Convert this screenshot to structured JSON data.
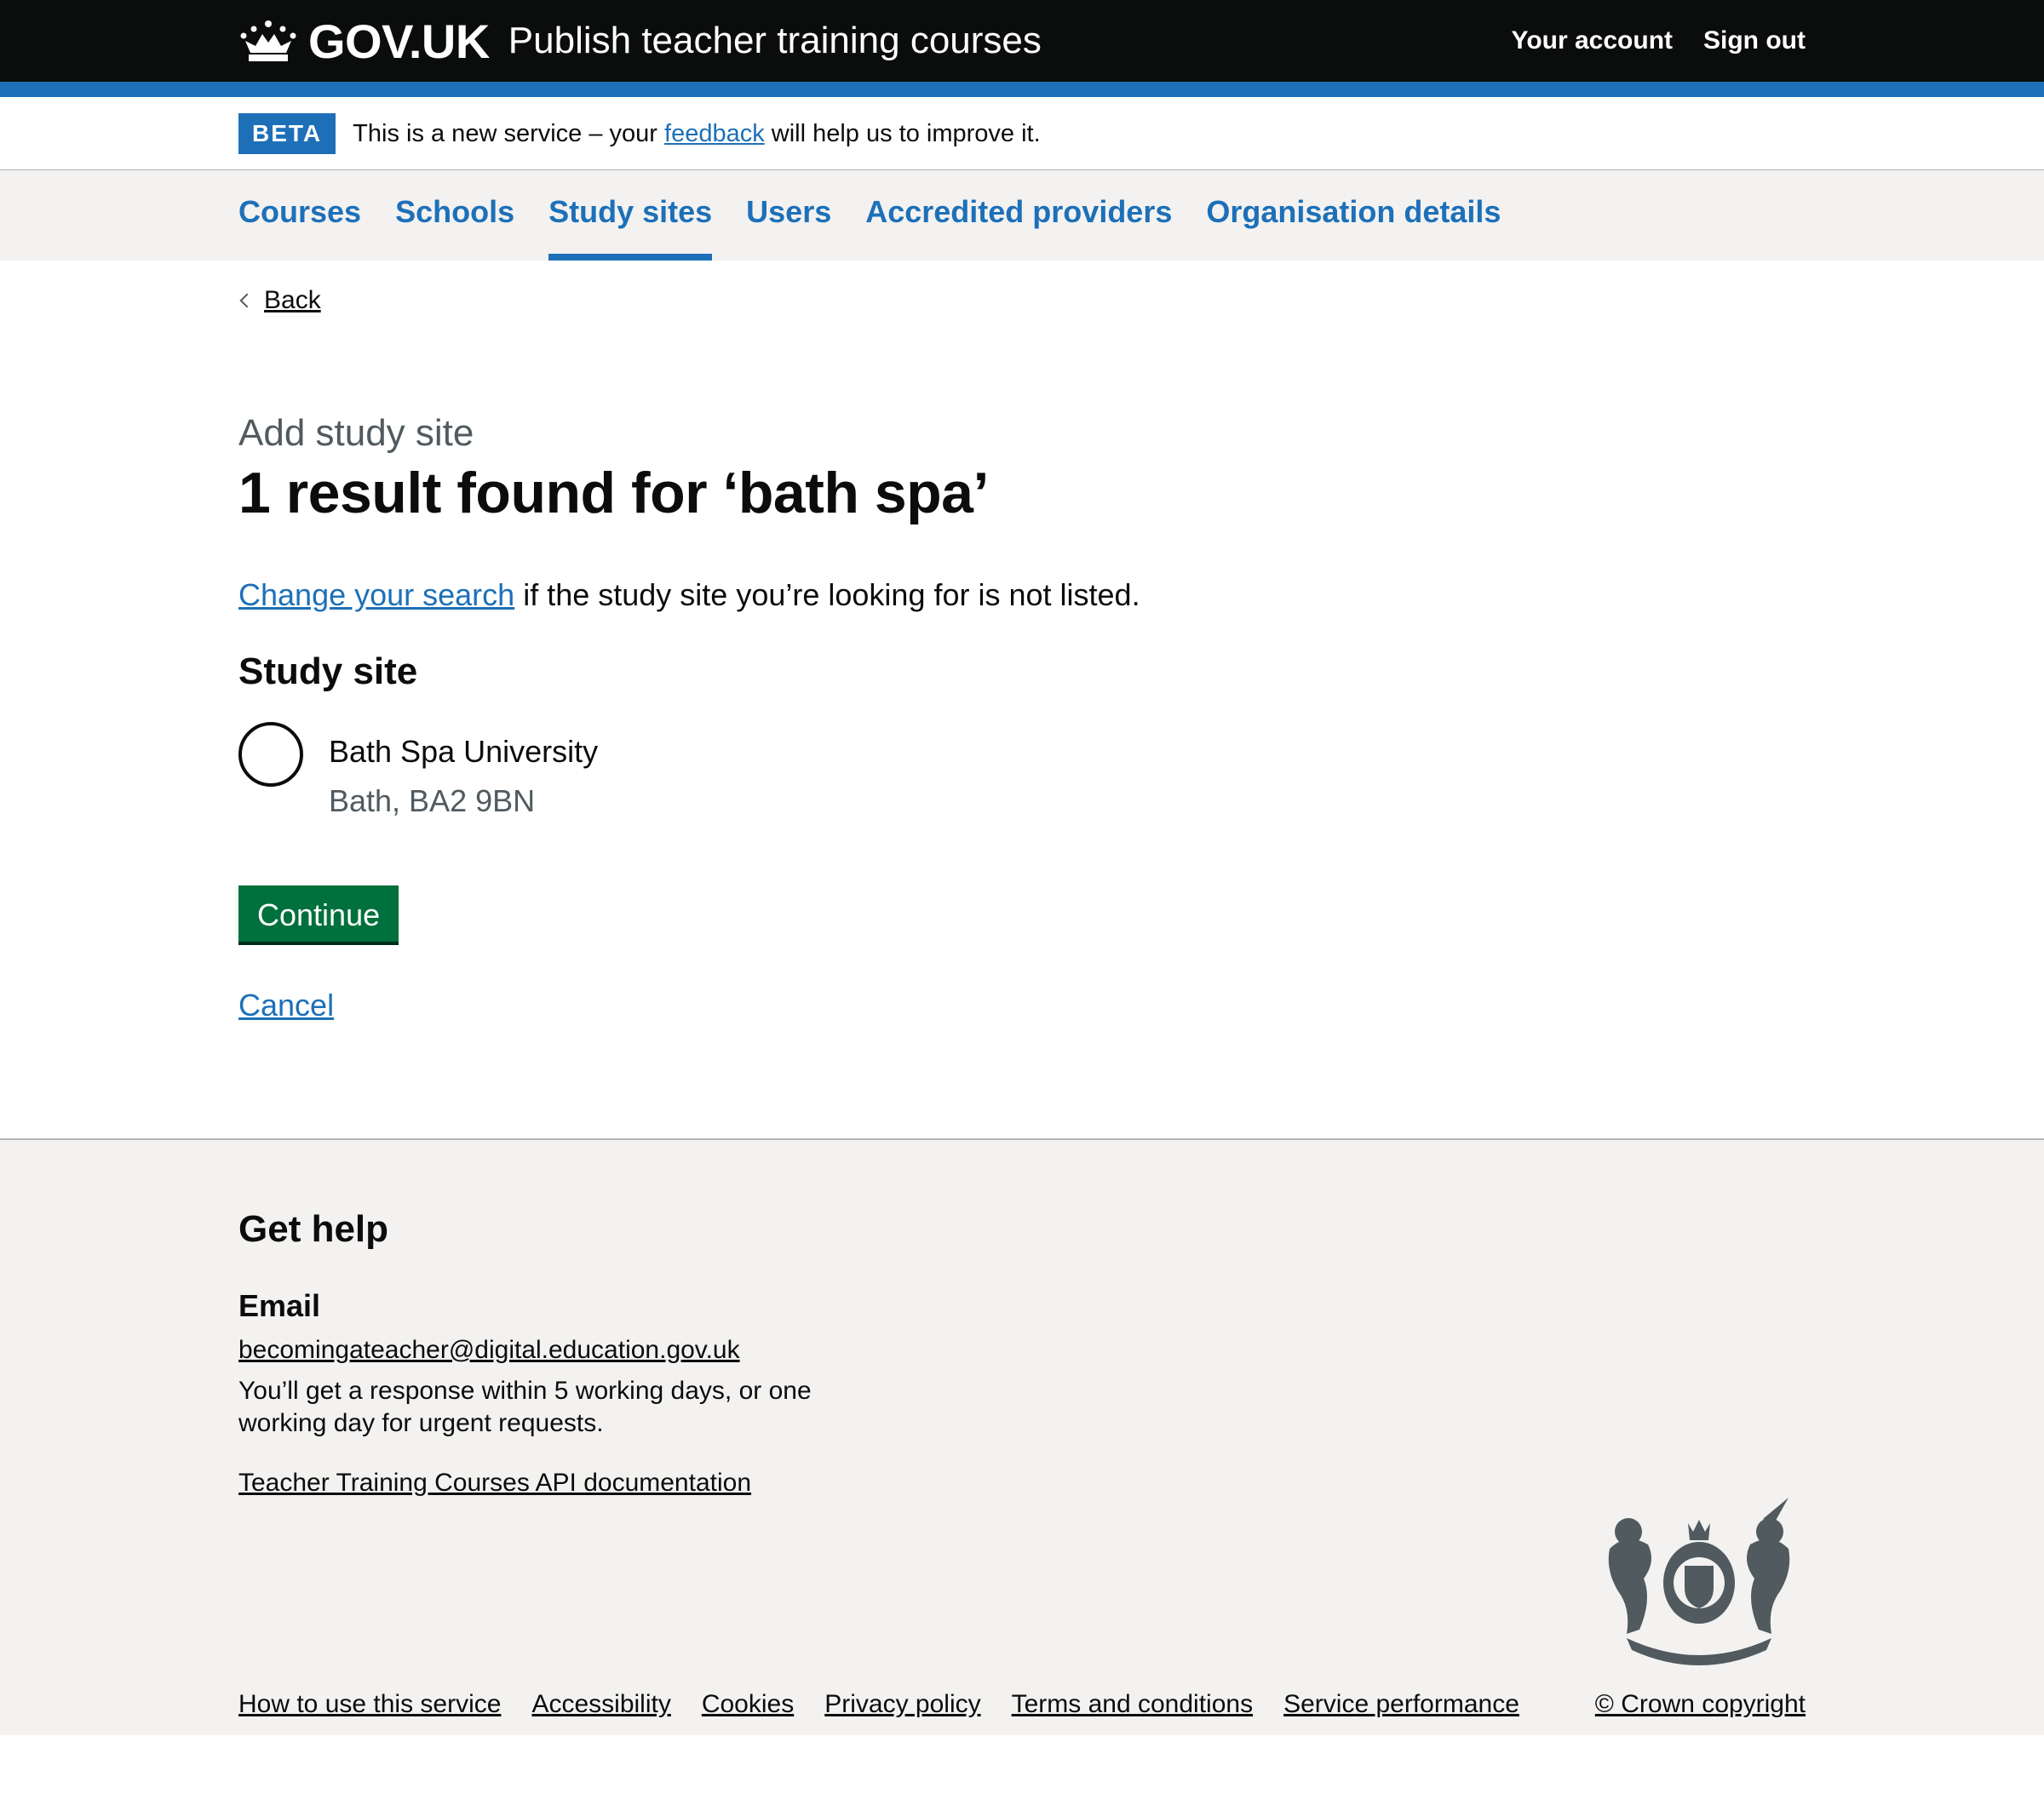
{
  "header": {
    "logo_text": "GOV.UK",
    "service_name": "Publish teacher training courses",
    "links": [
      "Your account",
      "Sign out"
    ]
  },
  "phase_banner": {
    "tag": "BETA",
    "text_before": "This is a new service – your ",
    "link": "feedback",
    "text_after": " will help us to improve it."
  },
  "nav": {
    "items": [
      "Courses",
      "Schools",
      "Study sites",
      "Users",
      "Accredited providers",
      "Organisation details"
    ],
    "active": "Study sites"
  },
  "main": {
    "back": "Back",
    "caption": "Add study site",
    "heading": "1 result found for ‘bath spa’",
    "change_link": "Change your search",
    "change_text": " if the study site you’re looking for is not listed.",
    "legend": "Study site",
    "option_label": "Bath Spa University",
    "option_hint": "Bath, BA2 9BN",
    "continue": "Continue",
    "cancel": "Cancel"
  },
  "footer": {
    "heading": "Get help",
    "email_heading": "Email",
    "email": "becomingateacher@digital.education.gov.uk",
    "response_text": "You’ll get a response within 5 working days, or one working day for urgent requests.",
    "api_link": "Teacher Training Courses API documentation",
    "links": [
      "How to use this service",
      "Accessibility",
      "Cookies",
      "Privacy policy",
      "Terms and conditions",
      "Service performance"
    ],
    "copyright": "© Crown copyright"
  },
  "colors": {
    "brand_blue": "#1d70b8",
    "header_black": "#0b0c0c",
    "button_green": "#00703c",
    "footer_grey": "#f3f2f1"
  }
}
